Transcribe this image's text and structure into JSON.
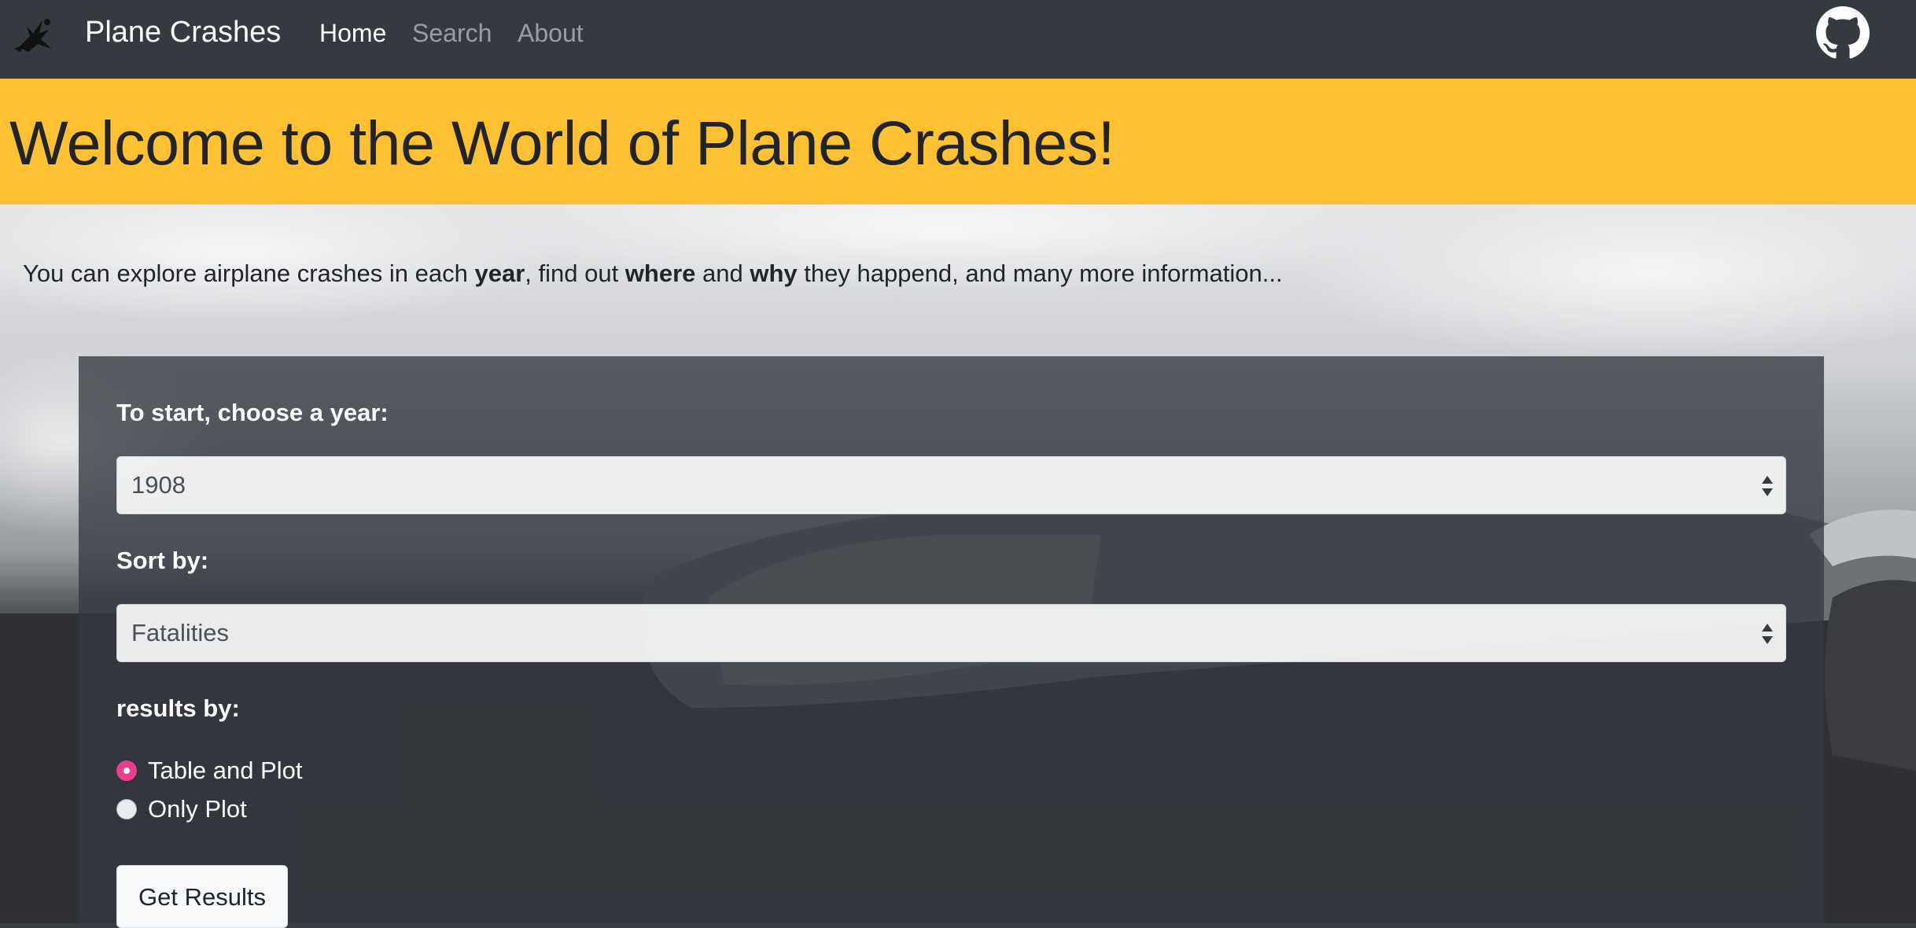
{
  "navbar": {
    "brand": "Plane Crashes",
    "links": [
      {
        "label": "Home",
        "active": true
      },
      {
        "label": "Search",
        "active": false
      },
      {
        "label": "About",
        "active": false
      }
    ],
    "github_icon": "github-icon",
    "brand_icon": "plane-crash-icon"
  },
  "hero": {
    "title": "Welcome to the World of Plane Crashes!",
    "background_color": "#fdc133"
  },
  "intro": {
    "part1": "You can explore airplane crashes in each ",
    "bold1": "year",
    "part2": ", find out ",
    "bold2": "where",
    "part3": " and ",
    "bold3": "why",
    "part4": " they happend, and many more information..."
  },
  "form": {
    "year_label": "To start, choose a year:",
    "year_value": "1908",
    "sort_label": "Sort by:",
    "sort_value": "Fatalities",
    "results_label": "results by:",
    "radio_options": [
      {
        "label": "Table and Plot",
        "checked": true
      },
      {
        "label": "Only Plot",
        "checked": false
      }
    ],
    "submit_label": "Get Results",
    "accent_color": "#e83e8c"
  }
}
